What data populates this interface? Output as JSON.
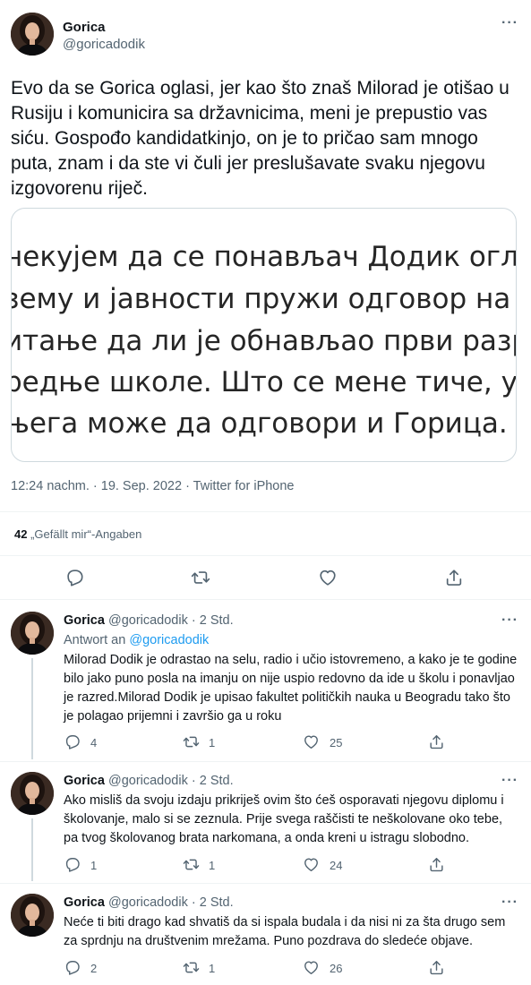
{
  "tweet": {
    "display_name": "Gorica",
    "handle": "@goricadodik",
    "text": "Evo da se Gorica oglasi, jer kao što znaš Milorad je otišao u Rusiju i komunicira sa državnicima, meni je prepustio vas siću. Gospođo kandidatkinjo, on je to pričao sam mnogo puta, znam i da ste vi čuli jer preslušavate svaku njegovu izgovorenu riječ.",
    "media_lines": [
      "некујем да се понављач Додик огласи",
      "зему и јавности пружи одговор на",
      "итање да ли је обнављао први разред",
      "редње школе. Што се мене тиче, умјест",
      "њега може да одговори и Горица."
    ],
    "timestamp": "12:24 nachm. · 19. Sep. 2022 · Twitter for iPhone",
    "likes_count": "42",
    "likes_label": "„Gefällt mir“-Angaben"
  },
  "replies": [
    {
      "display_name": "Gorica",
      "handle": "@goricadodik",
      "time": "· 2 Std.",
      "reply_to_prefix": "Antwort an",
      "reply_to_handle": "@goricadodik",
      "text": "Milorad Dodik je odrastao na selu, radio i učio istovremeno, a kako je te godine bilo jako puno posla na imanju on nije uspio redovno da ide u školu i ponavljao je razred.Milorad Dodik je upisao fakultet političkih nauka u Beogradu tako što je polagao prijemni i završio ga u roku",
      "reply_count": "4",
      "retweet_count": "1",
      "like_count": "25"
    },
    {
      "display_name": "Gorica",
      "handle": "@goricadodik",
      "time": "· 2 Std.",
      "text": "Ako misliš da svoju izdaju prikriješ ovim što ćeš osporavati njegovu diplomu i školovanje, malo si se zeznula. Prije svega raščisti te neškolovane oko tebe, pa tvog školovanog brata narkomana, a onda kreni u istragu slobodno.",
      "reply_count": "1",
      "retweet_count": "1",
      "like_count": "24"
    },
    {
      "display_name": "Gorica",
      "handle": "@goricadodik",
      "time": "· 2 Std.",
      "text": "Neće ti biti drago kad shvatiš da si ispala budala i da nisi ni za šta drugo sem za sprdnju na društvenim mrežama. Puno pozdrava do sledeće objave.",
      "reply_count": "2",
      "retweet_count": "1",
      "like_count": "26"
    }
  ],
  "colors": {
    "text": "#0f1419",
    "muted": "#536471",
    "link": "#1d9bf0",
    "border": "#cfd9de",
    "divider": "#eff3f4"
  },
  "icons": [
    "avatar",
    "more-icon",
    "reply-icon",
    "retweet-icon",
    "like-icon",
    "share-icon"
  ]
}
